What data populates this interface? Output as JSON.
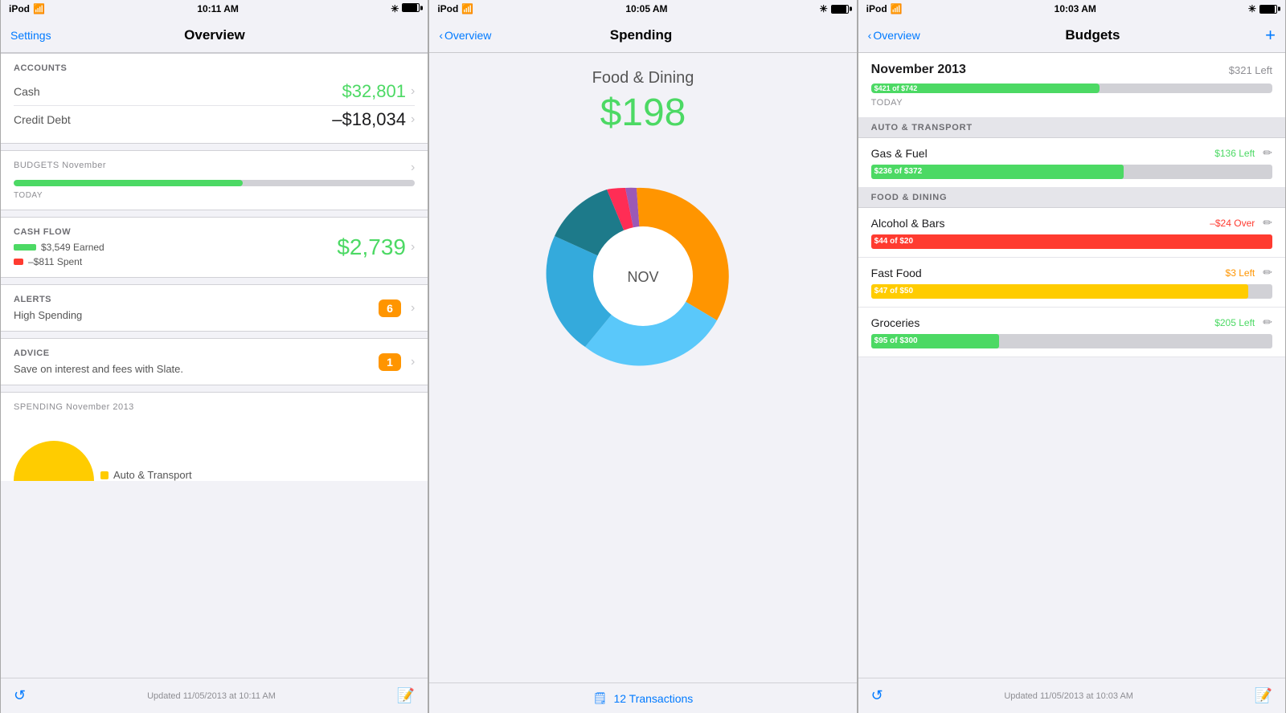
{
  "phone1": {
    "statusBar": {
      "left": "iPod",
      "time": "10:11 AM",
      "right": "🔋"
    },
    "nav": {
      "leftLabel": "Settings",
      "title": "Overview",
      "rightLabel": ""
    },
    "accounts": {
      "sectionLabel": "ACCOUNTS",
      "items": [
        {
          "name": "Cash",
          "value": "$32,801",
          "type": "green"
        },
        {
          "name": "Credit Debt",
          "value": "–$18,034",
          "type": "dark"
        }
      ]
    },
    "budgets": {
      "sectionLabel": "BUDGETS",
      "sectionSub": "November",
      "barPercent": 57,
      "todayLabel": "TODAY"
    },
    "cashflow": {
      "sectionLabel": "CASH FLOW",
      "earned": "$3,549 Earned",
      "spent": "–$811 Spent",
      "value": "$2,739"
    },
    "alerts": {
      "sectionLabel": "ALERTS",
      "text": "High Spending",
      "badge": "6"
    },
    "advice": {
      "sectionLabel": "ADVICE",
      "text": "Save on interest and fees with Slate.",
      "badge": "1"
    },
    "spending": {
      "sectionLabel": "SPENDING",
      "sectionSub": "November 2013",
      "legendLabel": "Auto & Transport"
    },
    "footer": {
      "text": "Updated 11/05/2013 at 10:11 AM"
    }
  },
  "phone2": {
    "statusBar": {
      "left": "iPod",
      "time": "10:05 AM",
      "right": "🔋"
    },
    "nav": {
      "leftLabel": "Overview",
      "title": "Spending",
      "rightLabel": ""
    },
    "header": {
      "category": "Food & Dining",
      "amount": "$198"
    },
    "donut": {
      "centerLabel": "NOV",
      "segments": [
        {
          "label": "Orange",
          "color": "#ff9500",
          "percent": 30
        },
        {
          "label": "Cyan",
          "color": "#5ac8fa",
          "percent": 28
        },
        {
          "label": "Teal",
          "color": "#34aadc",
          "percent": 18
        },
        {
          "label": "DarkTeal",
          "color": "#1d7a8a",
          "percent": 10
        },
        {
          "label": "Pink",
          "color": "#ff2d55",
          "percent": 5
        },
        {
          "label": "Purple",
          "color": "#9b59b6",
          "percent": 5
        },
        {
          "label": "OrangeYellow",
          "color": "#ff9500",
          "percent": 4
        }
      ]
    },
    "transactions": {
      "icon": "📋",
      "label": "12 Transactions"
    }
  },
  "phone3": {
    "statusBar": {
      "left": "iPod",
      "time": "10:03 AM",
      "right": "🔋"
    },
    "nav": {
      "leftLabel": "Overview",
      "title": "Budgets",
      "rightLabel": "+"
    },
    "november": {
      "title": "November 2013",
      "leftAmount": "$321 Left",
      "barLabel": "$421 of $742",
      "barPercent": 57,
      "todayLabel": "TODAY"
    },
    "sections": [
      {
        "header": "AUTO & TRANSPORT",
        "items": [
          {
            "name": "Gas & Fuel",
            "status": "$136 Left",
            "statusType": "green",
            "barLabel": "$236 of $372",
            "barPercent": 63,
            "barType": "green"
          }
        ]
      },
      {
        "header": "FOOD & DINING",
        "items": [
          {
            "name": "Alcohol & Bars",
            "status": "–$24 Over",
            "statusType": "red",
            "barLabel": "$44 of $20",
            "barPercent": 100,
            "barType": "red"
          },
          {
            "name": "Fast Food",
            "status": "$3 Left",
            "statusType": "yellow",
            "barLabel": "$47 of $50",
            "barPercent": 94,
            "barType": "yellow"
          },
          {
            "name": "Groceries",
            "status": "$205 Left",
            "statusType": "green",
            "barLabel": "$95 of $300",
            "barPercent": 32,
            "barType": "green"
          }
        ]
      }
    ],
    "footer": {
      "text": "Updated 11/05/2013 at 10:03 AM"
    }
  },
  "icons": {
    "chevron": "›",
    "back": "‹",
    "refresh": "↺",
    "edit": "✏",
    "transactions": "🗒"
  }
}
